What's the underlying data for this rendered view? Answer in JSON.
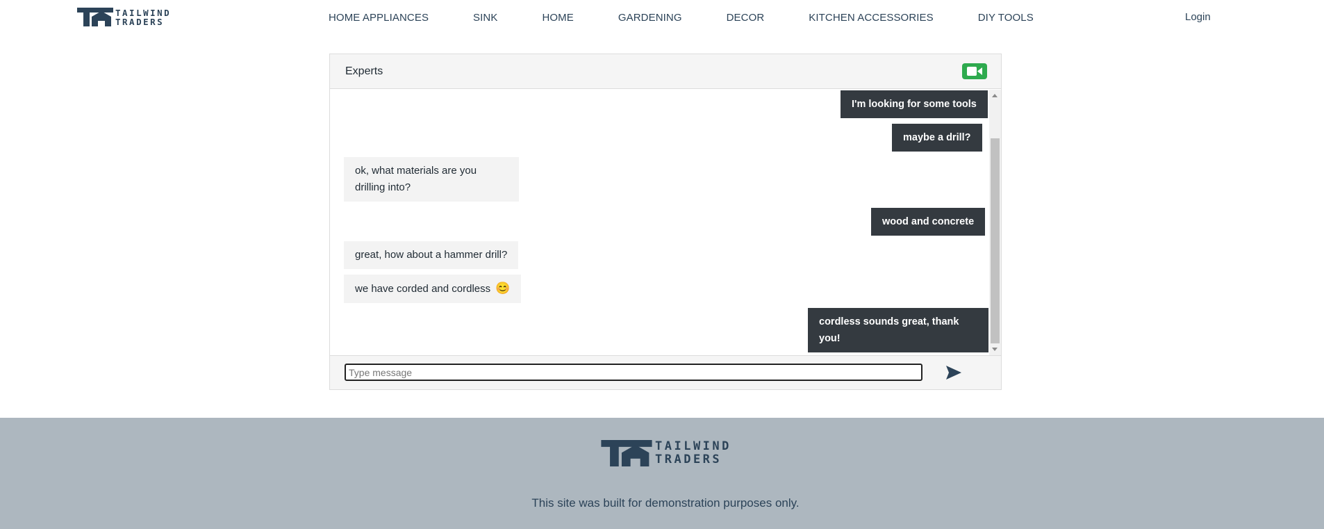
{
  "brand": {
    "line1": "TAILWIND",
    "line2": "TRADERS",
    "color": "#2c4358"
  },
  "nav": {
    "items": [
      {
        "label": "HOME APPLIANCES"
      },
      {
        "label": "SINK"
      },
      {
        "label": "HOME"
      },
      {
        "label": "GARDENING"
      },
      {
        "label": "DECOR"
      },
      {
        "label": "KITCHEN ACCESSORIES"
      },
      {
        "label": "DIY TOOLS"
      }
    ],
    "login": "Login"
  },
  "chat": {
    "title": "Experts",
    "video_icon": "video-camera-icon",
    "video_button_color": "#2eaa4e",
    "messages": [
      {
        "from": "user",
        "text": "I'm looking for some tools"
      },
      {
        "from": "user",
        "text": "maybe a drill?"
      },
      {
        "from": "expert",
        "text": "ok, what materials are you drilling into?"
      },
      {
        "from": "user",
        "text": "wood and concrete"
      },
      {
        "from": "expert",
        "text": "great, how about a hammer drill?"
      },
      {
        "from": "expert",
        "text": "we have corded and cordless",
        "emoji": "😊"
      },
      {
        "from": "user",
        "text": "cordless sounds great, thank you!"
      }
    ],
    "input": {
      "placeholder": "Type message",
      "value": ""
    },
    "send_icon": "send-icon"
  },
  "footer": {
    "note": "This site was built for demonstration purposes only.",
    "background": "#adb7bf"
  }
}
